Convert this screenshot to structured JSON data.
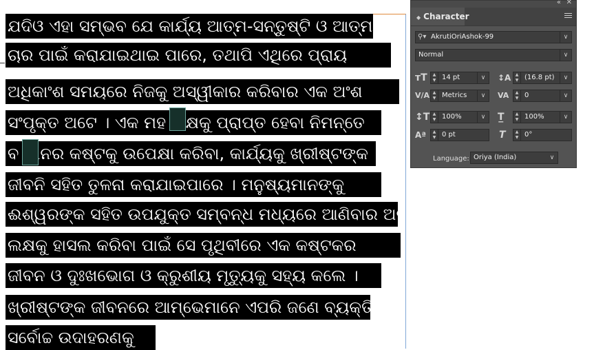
{
  "document": {
    "lines": [
      "ଯଦିଓ ଏହା ସମ୍ଭବ ଯେ କାର୍ଯ୍ୟ ଆତ୍ମ-ସନ୍ତୁଷ୍ଟି ଓ ଆତ୍ମ-ପ",
      "ଚାର ପାଇଁ କରାଯାଇଥାଇ ପାରେ, ତଥାପି ଏଥିରେ ପ୍ରାୟ",
      "ଅଧିକାଂଶ ସମୟରେ ନିଜକୁ ଅସ୍ୱୀକାର କରିବାର ଏକ ଅଂଶ",
      "ସଂପୃକ୍ତ ଅଟେ । ଏକ ମହ  ଲକ୍ଷକୁ ପ୍ରାପ୍ତ ହେବା ନିମନ୍ତେ",
      "ବ  ମାନର କଷ୍ଟକୁ ଉପେକ୍ଷା କରିବା, କାର୍ଯ୍ୟକୁ ଖ୍ରୀଷ୍ଟଙ୍କ",
      "ଜୀବନି ସହିତ ତୁଳନା କରାଯାଇପାରେ । ମନୁଷ୍ୟମାନଙ୍କୁ",
      "ଈଶ୍ୱରଙ୍କ ସହିତ ଉପଯୁକ୍ତ ସମ୍ବନ୍ଧ ମଧ୍ୟରେ ଆଣିବାର ଅନ୍ତିମ",
      "ଲକ୍ଷକୁ ହାସଲ କରିବା ପାଇଁ ସେ ପୃଥିବୀରେ ଏକ କଷ୍ଟକର",
      "ଜୀବନ ଓ ଦୁଃଖଭୋଗ ଓ କ୍ରୁଶୀୟ ମୃତ୍ୟୁକୁ ସହ୍ୟ କଲେ ।",
      "ଖ୍ରୀଷ୍ଟଙ୍କ ଜୀବନରେ ଆମ୍ଭେମାନେ ଏପରି ଜଣେ ବ୍ୟକ୍ତିଙ୍କ",
      "ସର୍ବୋଚ୍ଚ ଉଦାହରଣକୁ"
    ]
  },
  "panel": {
    "title": "Character",
    "font_family": "AkrutiOriAshok-99",
    "font_style": "Normal",
    "font_size": "14 pt",
    "leading": "(16.8 pt)",
    "kerning": "Metrics",
    "tracking": "0",
    "vertical_scale": "100%",
    "horizontal_scale": "100%",
    "baseline_shift": "0 pt",
    "skew": "0°",
    "language_label": "Language:",
    "language": "Oriya (India)"
  },
  "colors": {
    "highlight": "#000000",
    "panel_bg": "#535353",
    "field_bg": "#3d3d3d"
  }
}
